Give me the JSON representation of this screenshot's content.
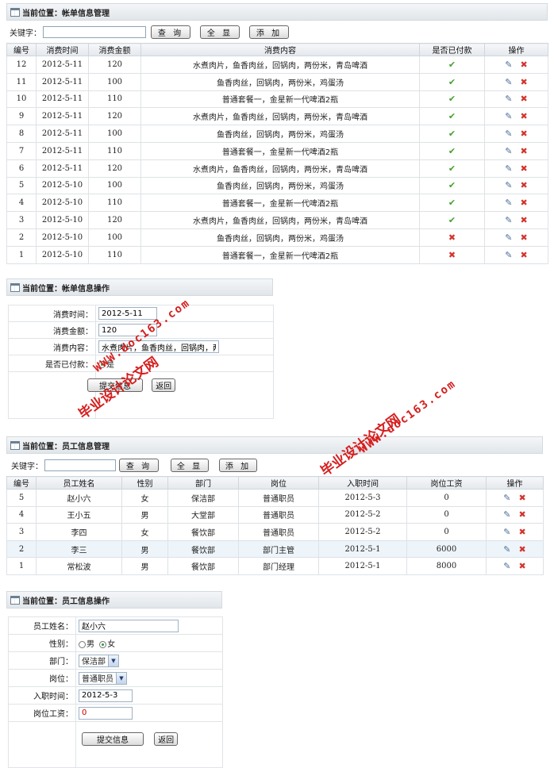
{
  "bill_list": {
    "header": "当前位置：帐单信息管理",
    "search_label": "关键字：",
    "search_value": "",
    "buttons": {
      "query": "查 询",
      "show_all": "全 显",
      "add": "添 加"
    },
    "columns": [
      "编号",
      "消费时间",
      "消费金额",
      "消费内容",
      "是否已付款",
      "操作"
    ],
    "rows": [
      {
        "id": "12",
        "time": "2012-5-11",
        "amount": "120",
        "content": "水煮肉片，鱼香肉丝，回锅肉，两份米，青岛啤酒",
        "paid": "yes"
      },
      {
        "id": "11",
        "time": "2012-5-11",
        "amount": "100",
        "content": "鱼香肉丝，回锅肉，两份米，鸡蛋汤",
        "paid": "yes"
      },
      {
        "id": "10",
        "time": "2012-5-11",
        "amount": "110",
        "content": "普通套餐一，金星新一代啤酒2瓶",
        "paid": "yes"
      },
      {
        "id": "9",
        "time": "2012-5-11",
        "amount": "120",
        "content": "水煮肉片，鱼香肉丝，回锅肉，两份米，青岛啤酒",
        "paid": "yes"
      },
      {
        "id": "8",
        "time": "2012-5-11",
        "amount": "100",
        "content": "鱼香肉丝，回锅肉，两份米，鸡蛋汤",
        "paid": "yes"
      },
      {
        "id": "7",
        "time": "2012-5-11",
        "amount": "110",
        "content": "普通套餐一，金星新一代啤酒2瓶",
        "paid": "yes"
      },
      {
        "id": "6",
        "time": "2012-5-11",
        "amount": "120",
        "content": "水煮肉片，鱼香肉丝，回锅肉，两份米，青岛啤酒",
        "paid": "yes"
      },
      {
        "id": "5",
        "time": "2012-5-10",
        "amount": "100",
        "content": "鱼香肉丝，回锅肉，两份米，鸡蛋汤",
        "paid": "yes"
      },
      {
        "id": "4",
        "time": "2012-5-10",
        "amount": "110",
        "content": "普通套餐一，金星新一代啤酒2瓶",
        "paid": "yes"
      },
      {
        "id": "3",
        "time": "2012-5-10",
        "amount": "120",
        "content": "水煮肉片，鱼香肉丝，回锅肉，两份米，青岛啤酒",
        "paid": "yes"
      },
      {
        "id": "2",
        "time": "2012-5-10",
        "amount": "100",
        "content": "鱼香肉丝，回锅肉，两份米，鸡蛋汤",
        "paid": "no"
      },
      {
        "id": "1",
        "time": "2012-5-10",
        "amount": "110",
        "content": "普通套餐一，金星新一代啤酒2瓶",
        "paid": "no"
      }
    ]
  },
  "bill_form": {
    "header": "当前位置：帐单信息操作",
    "labels": {
      "time": "消费时间：",
      "amount": "消费金额：",
      "content": "消费内容：",
      "paid": "是否已付款："
    },
    "values": {
      "time": "2012-5-11",
      "amount": "120",
      "content": "水煮肉片，鱼香肉丝，回锅肉，两份"
    },
    "paid_option": "是",
    "submit": "提交信息",
    "back": "返回"
  },
  "staff_list": {
    "header": "当前位置：员工信息管理",
    "search_label": "关键字：",
    "search_value": "",
    "buttons": {
      "query": "查 询",
      "show_all": "全 显",
      "add": "添 加"
    },
    "columns": [
      "编号",
      "员工姓名",
      "性别",
      "部门",
      "岗位",
      "入职时间",
      "岗位工资",
      "操作"
    ],
    "rows": [
      {
        "id": "5",
        "name": "赵小六",
        "gender": "女",
        "dept": "保洁部",
        "post": "普通职员",
        "date": "2012-5-3",
        "salary": "0"
      },
      {
        "id": "4",
        "name": "王小五",
        "gender": "男",
        "dept": "大堂部",
        "post": "普通职员",
        "date": "2012-5-2",
        "salary": "0"
      },
      {
        "id": "3",
        "name": "李四",
        "gender": "女",
        "dept": "餐饮部",
        "post": "普通职员",
        "date": "2012-5-2",
        "salary": "0"
      },
      {
        "id": "2",
        "name": "李三",
        "gender": "男",
        "dept": "餐饮部",
        "post": "部门主管",
        "date": "2012-5-1",
        "salary": "6000"
      },
      {
        "id": "1",
        "name": "常松波",
        "gender": "男",
        "dept": "餐饮部",
        "post": "部门经理",
        "date": "2012-5-1",
        "salary": "8000"
      }
    ]
  },
  "staff_form": {
    "header": "当前位置：员工信息操作",
    "labels": {
      "name": "员工姓名：",
      "gender": "性别：",
      "dept": "部门：",
      "post": "岗位：",
      "date": "入职时间：",
      "salary": "岗位工资："
    },
    "values": {
      "name": "赵小六",
      "dept": "保洁部",
      "post": "普通职员",
      "date": "2012-5-3",
      "salary": "0"
    },
    "gender_options": {
      "male": "男",
      "female": "女"
    },
    "submit": "提交信息",
    "back": "返回"
  },
  "watermarks": {
    "cn": "毕业设计论文网",
    "url": "WWW.doc163.com"
  },
  "colors": {
    "paid_yes": "#43a02a",
    "paid_no": "#d2352f",
    "accent_red": "#d61e1e"
  }
}
